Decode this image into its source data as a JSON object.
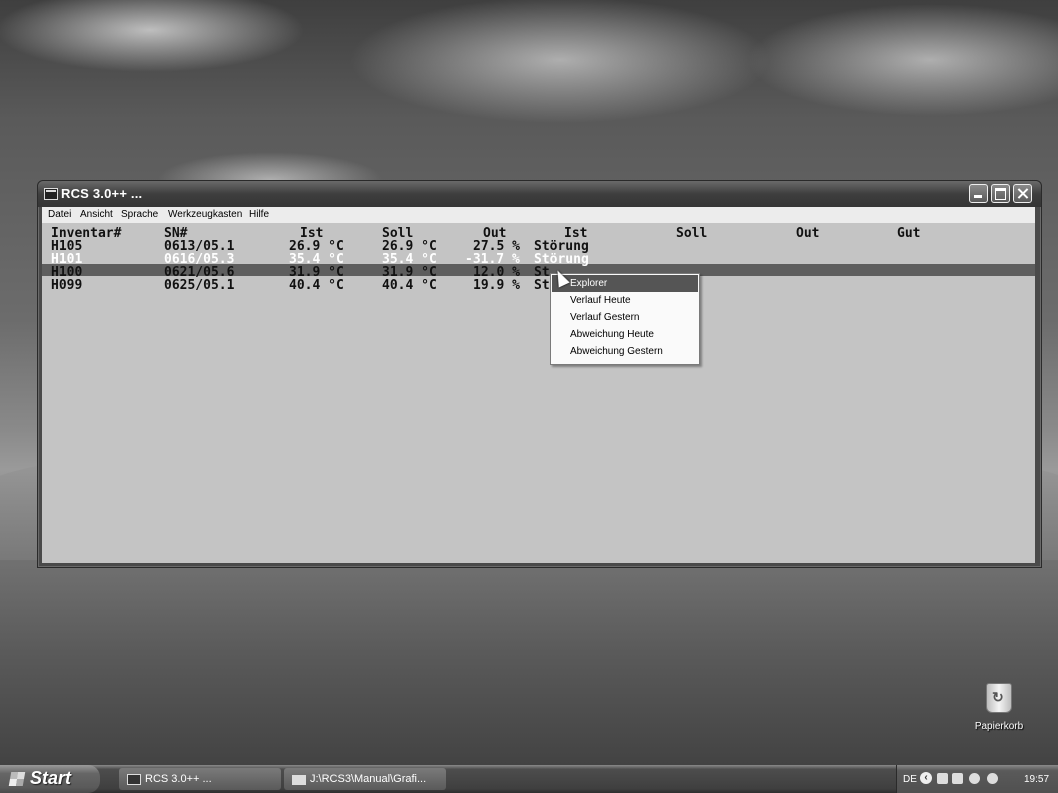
{
  "window": {
    "title": "RCS 3.0++ ...",
    "controls": {
      "minimize": "minimize",
      "maximize": "maximize",
      "close": "close"
    }
  },
  "menubar": [
    "Datei",
    "Ansicht",
    "Sprache",
    "Werkzeugkasten",
    "Hilfe"
  ],
  "table": {
    "headers": [
      "Inventar#",
      "SN#",
      "Ist",
      "Soll",
      "Out",
      "Ist",
      "Soll",
      "Out",
      "Gut"
    ],
    "rows": [
      {
        "inventar": "H105",
        "sn": "0613/05.1",
        "ist": "26.9 °C",
        "soll": "26.9 °C",
        "out": "27.5 %",
        "status": "Störung",
        "selected": false
      },
      {
        "inventar": "H101",
        "sn": "0616/05.3",
        "ist": "35.4 °C",
        "soll": "35.4 °C",
        "out": "-31.7 %",
        "status": "Störung",
        "selected": true
      },
      {
        "inventar": "H100",
        "sn": "0621/05.6",
        "ist": "31.9 °C",
        "soll": "31.9 °C",
        "out": "12.0 %",
        "status": "St",
        "selected": false
      },
      {
        "inventar": "H099",
        "sn": "0625/05.1",
        "ist": "40.4 °C",
        "soll": "40.4 °C",
        "out": "19.9 %",
        "status": "St",
        "selected": false
      }
    ]
  },
  "context_menu": {
    "items": [
      "Explorer",
      "Verlauf Heute",
      "Verlauf Gestern",
      "Abweichung Heute",
      "Abweichung Gestern"
    ],
    "selected_index": 0
  },
  "desktop": {
    "recycle_bin_label": "Papierkorb"
  },
  "taskbar": {
    "start_label": "Start",
    "tasks": [
      "RCS 3.0++ ...",
      "J:\\RCS3\\Manual\\Grafi..."
    ],
    "tray": {
      "language": "DE",
      "clock": "19:57"
    }
  }
}
